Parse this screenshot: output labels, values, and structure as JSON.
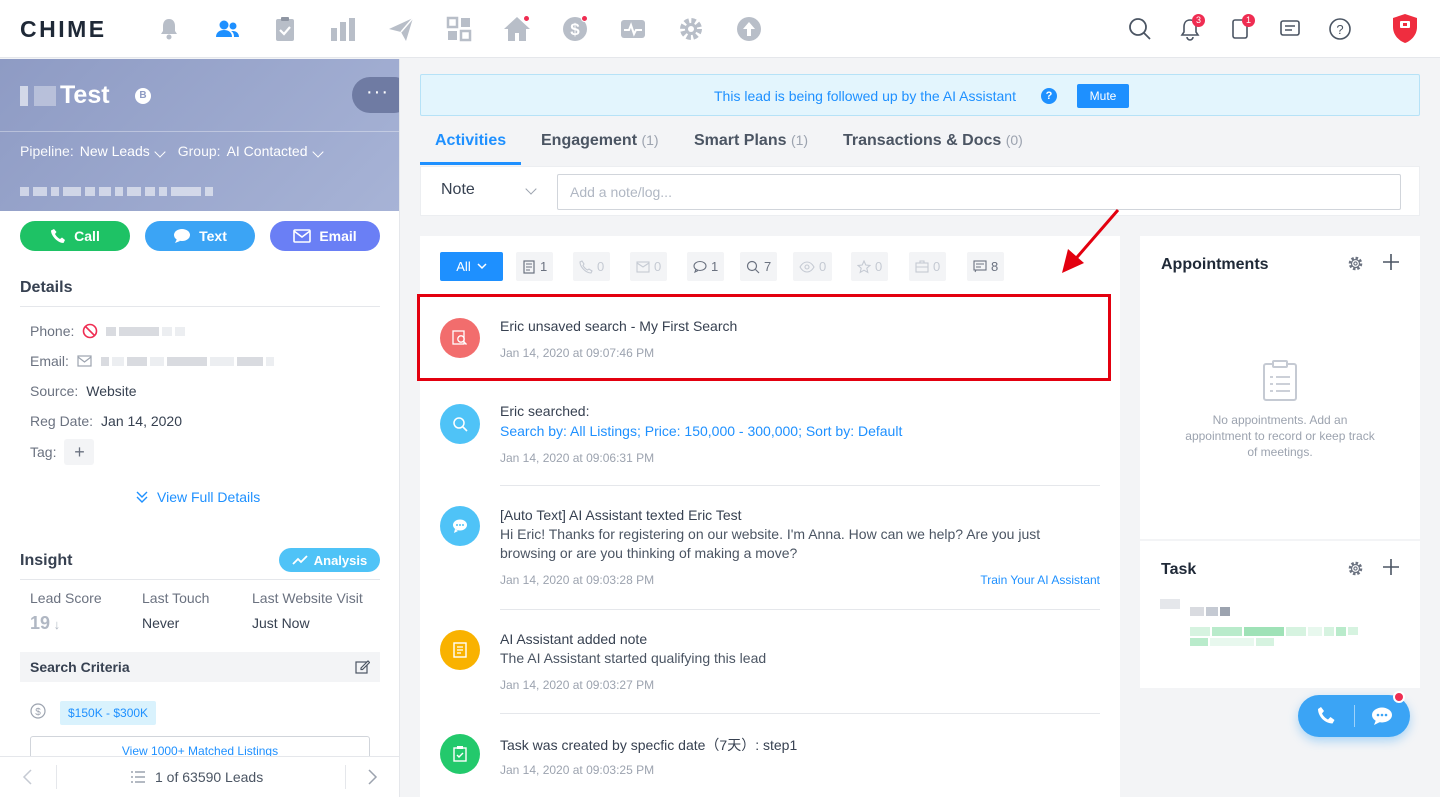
{
  "brand": {
    "logo": "CHIME"
  },
  "left": {
    "lead_name_suffix": "Test",
    "lead_badge": "B",
    "more": "···",
    "pipeline_label": "Pipeline:",
    "pipeline_value": "New Leads",
    "group_label": "Group:",
    "group_value": "AI Contacted",
    "actions": {
      "call": "Call",
      "text": "Text",
      "email": "Email"
    },
    "details_title": "Details",
    "phone_label": "Phone:",
    "email_label": "Email:",
    "source_label": "Source:",
    "source_value": "Website",
    "regdate_label": "Reg Date:",
    "regdate_value": "Jan 14, 2020",
    "tag_label": "Tag:",
    "view_full_details": "View Full Details",
    "insight_title": "Insight",
    "analysis": "Analysis",
    "lead_score_label": "Lead Score",
    "lead_score_value": "19",
    "last_touch_label": "Last Touch",
    "last_touch_value": "Never",
    "last_visit_label": "Last Website Visit",
    "last_visit_value": "Just Now",
    "search_criteria": "Search Criteria",
    "price_range": "$150K - $300K",
    "matched_listings": "View 1000+ Matched Listings",
    "pager": "1 of 63590 Leads"
  },
  "banner": {
    "message": "This lead is being followed up by the AI Assistant",
    "help": "?",
    "mute": "Mute"
  },
  "tabs": [
    {
      "label": "Activities",
      "count": ""
    },
    {
      "label": "Engagement",
      "count": "(1)"
    },
    {
      "label": "Smart Plans",
      "count": "(1)"
    },
    {
      "label": "Transactions & Docs",
      "count": "(0)"
    }
  ],
  "note": {
    "type": "Note",
    "placeholder": "Add a note/log..."
  },
  "filters": {
    "all": "All",
    "counts": [
      "1",
      "0",
      "0",
      "1",
      "7",
      "0",
      "0",
      "0",
      "8"
    ]
  },
  "activities": [
    {
      "title": "Eric unsaved search - My First Search",
      "body": "",
      "link": "",
      "time": "Jan 14, 2020 at 09:07:46 PM"
    },
    {
      "title": "Eric searched:",
      "body": "",
      "link": "Search by: All Listings; Price: 150,000 - 300,000; Sort by: Default",
      "time": "Jan 14, 2020 at 09:06:31 PM"
    },
    {
      "title": "[Auto Text] AI Assistant texted Eric Test",
      "body": "Hi Eric! Thanks for registering on our website. I'm Anna. How can we help? Are you just browsing or are you thinking of making a move?",
      "link": "",
      "time": "Jan 14, 2020 at 09:03:28 PM",
      "action": "Train Your AI Assistant"
    },
    {
      "title": "AI Assistant added note",
      "body": "The AI Assistant started qualifying this lead",
      "link": "",
      "time": "Jan 14, 2020 at 09:03:27 PM"
    },
    {
      "title": "Task was created by specfic date（7天）: step1",
      "body": "",
      "link": "",
      "time": "Jan 14, 2020 at 09:03:25 PM"
    }
  ],
  "appointments": {
    "title": "Appointments",
    "empty": "No appointments. Add an appointment to record or keep track of meetings."
  },
  "task": {
    "title": "Task"
  },
  "notifications": {
    "bell_count": "3",
    "tasks_count": "1"
  },
  "colors": {
    "accent": "#1e90ff",
    "call": "#1ec265",
    "text": "#3ba4f5",
    "email": "#6a7ff5",
    "red_highlight": "#e3000f"
  }
}
